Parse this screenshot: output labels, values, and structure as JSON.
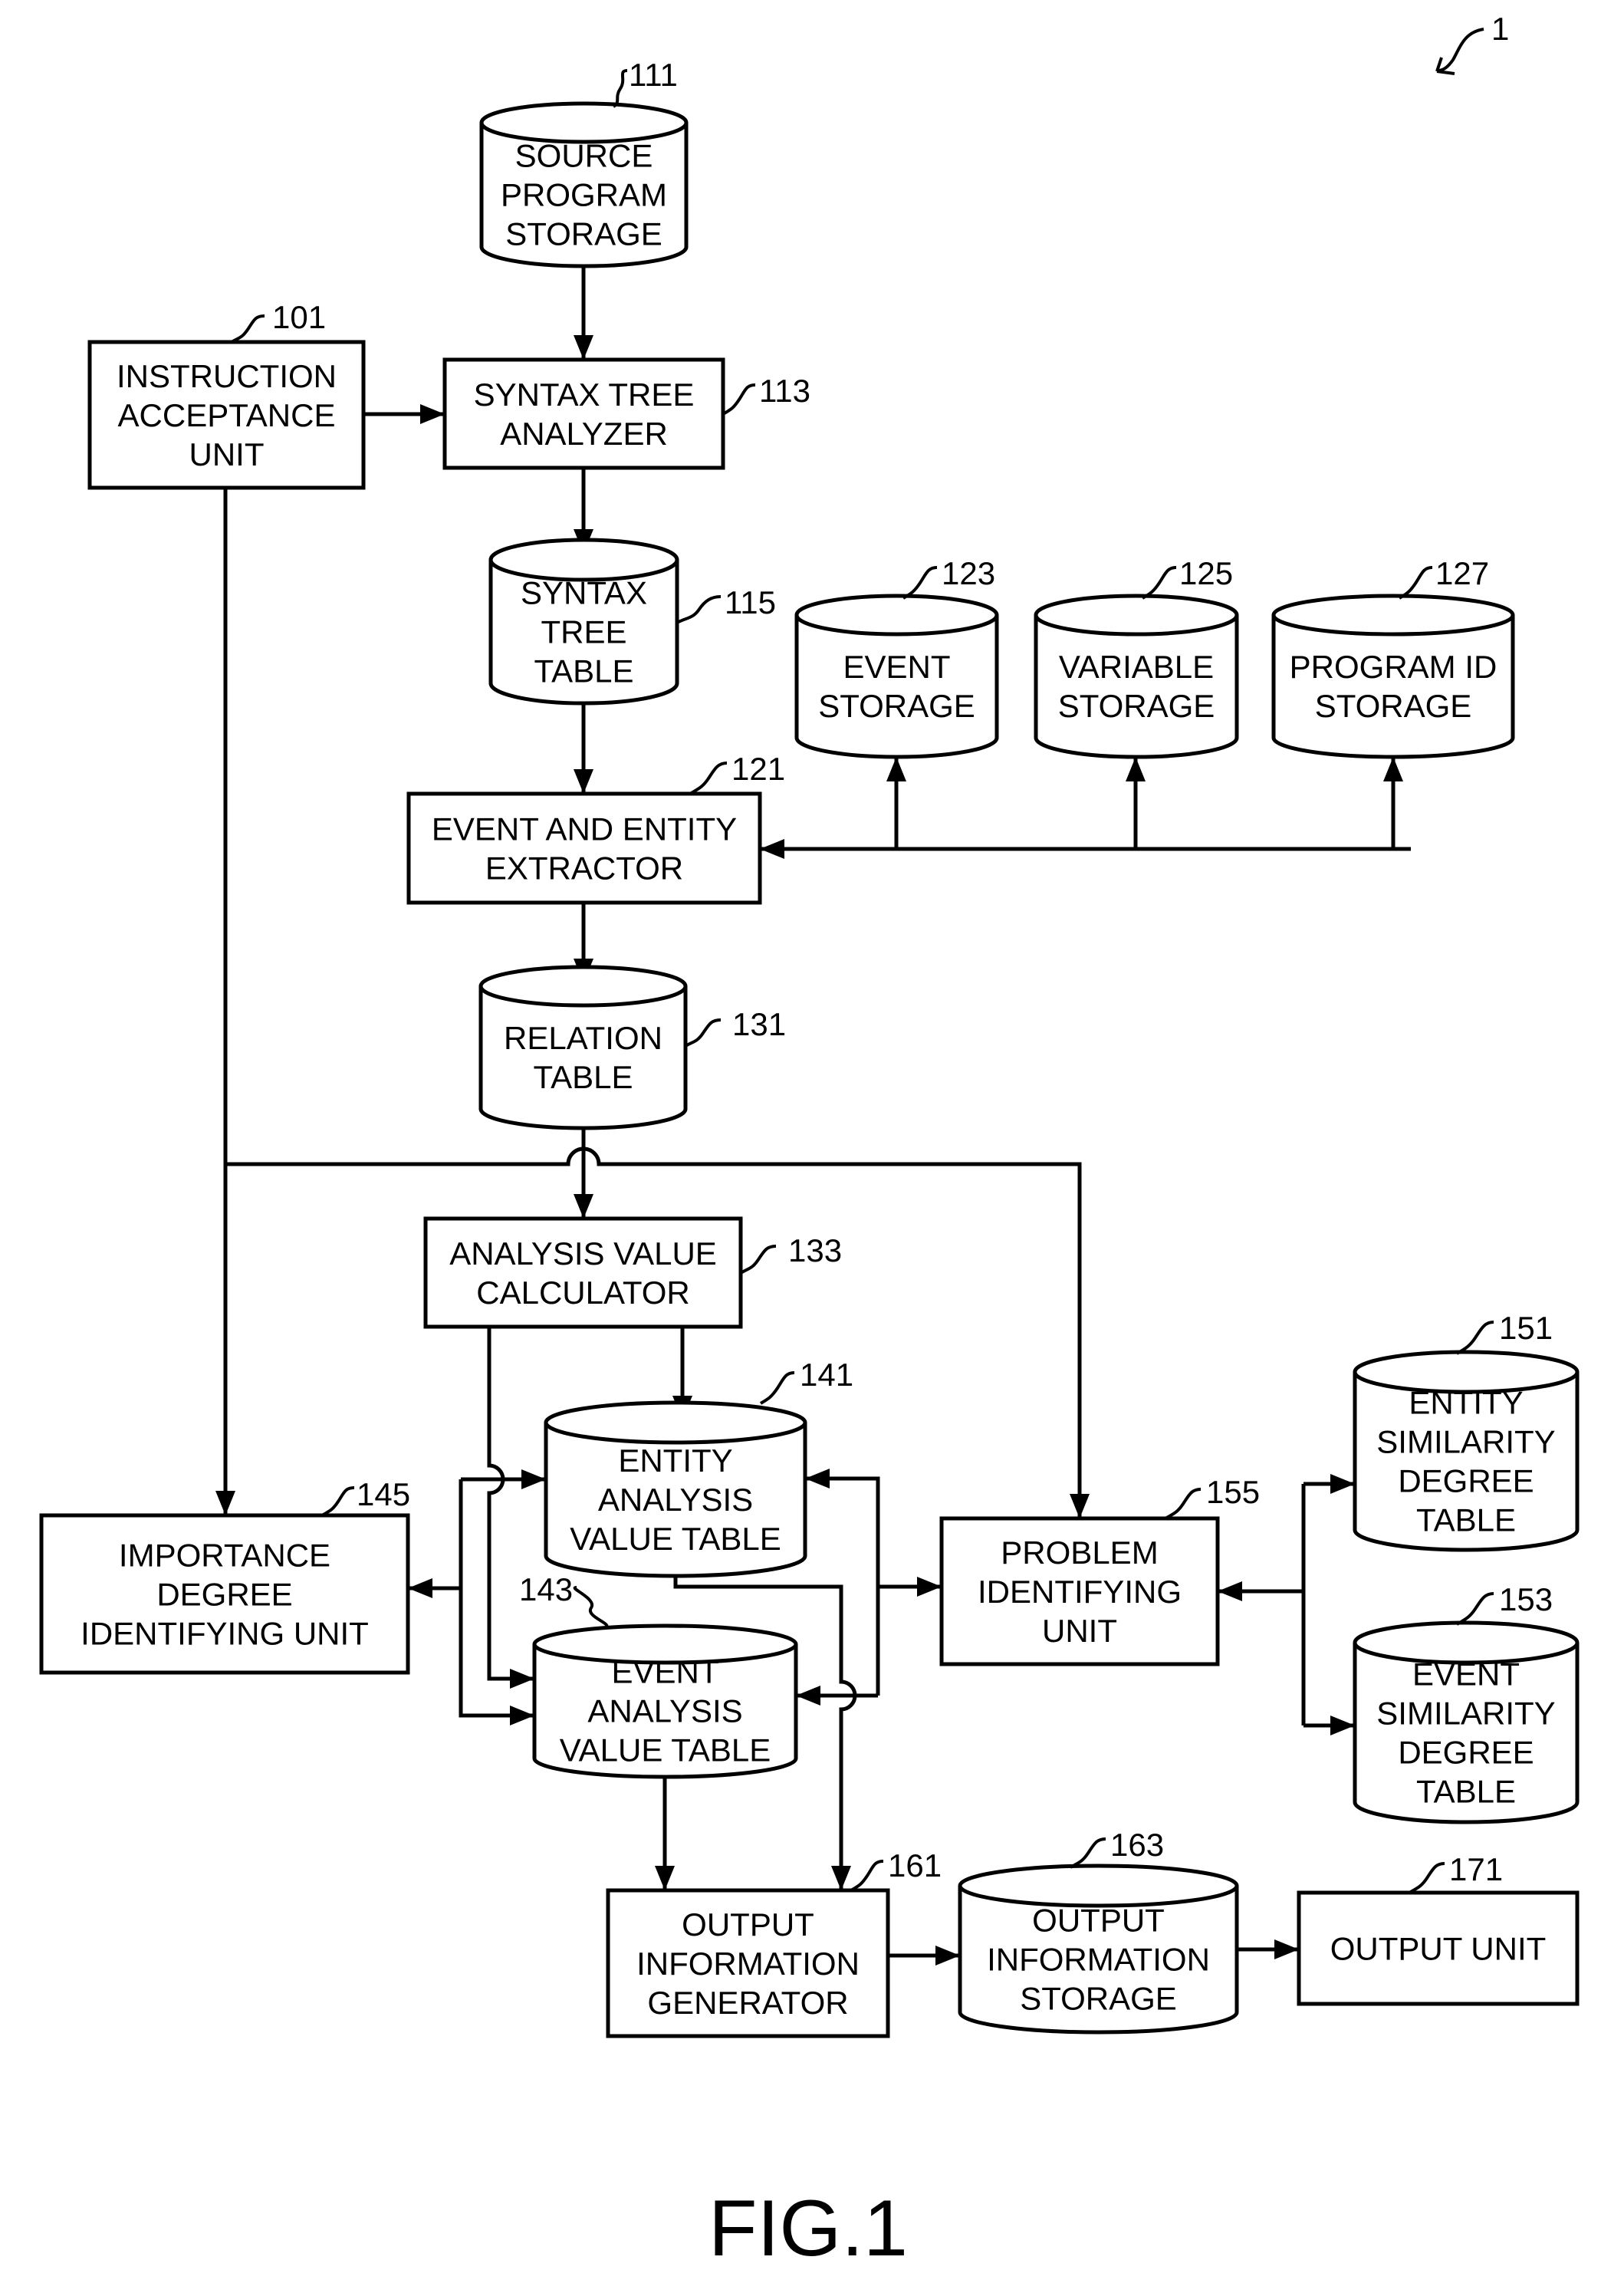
{
  "figure": {
    "label": "FIG.1",
    "system_ref": "1"
  },
  "nodes": {
    "source_program_storage": {
      "ref": "111",
      "type": "storage",
      "lines": [
        "SOURCE",
        "PROGRAM",
        "STORAGE"
      ]
    },
    "instruction_acceptance_unit": {
      "ref": "101",
      "type": "unit",
      "lines": [
        "INSTRUCTION",
        "ACCEPTANCE",
        "UNIT"
      ]
    },
    "syntax_tree_analyzer": {
      "ref": "113",
      "type": "unit",
      "lines": [
        "SYNTAX TREE",
        "ANALYZER"
      ]
    },
    "syntax_tree_table": {
      "ref": "115",
      "type": "storage",
      "lines": [
        "SYNTAX",
        "TREE",
        "TABLE"
      ]
    },
    "event_storage": {
      "ref": "123",
      "type": "storage",
      "lines": [
        "EVENT",
        "STORAGE"
      ]
    },
    "variable_storage": {
      "ref": "125",
      "type": "storage",
      "lines": [
        "VARIABLE",
        "STORAGE"
      ]
    },
    "program_id_storage": {
      "ref": "127",
      "type": "storage",
      "lines": [
        "PROGRAM ID",
        "STORAGE"
      ]
    },
    "event_entity_extractor": {
      "ref": "121",
      "type": "unit",
      "lines": [
        "EVENT AND ENTITY",
        "EXTRACTOR"
      ]
    },
    "relation_table": {
      "ref": "131",
      "type": "storage",
      "lines": [
        "RELATION",
        "TABLE"
      ]
    },
    "analysis_value_calculator": {
      "ref": "133",
      "type": "unit",
      "lines": [
        "ANALYSIS VALUE",
        "CALCULATOR"
      ]
    },
    "entity_analysis_value_table": {
      "ref": "141",
      "type": "storage",
      "lines": [
        "ENTITY",
        "ANALYSIS",
        "VALUE TABLE"
      ]
    },
    "event_analysis_value_table": {
      "ref": "143",
      "type": "storage",
      "lines": [
        "EVENT",
        "ANALYSIS",
        "VALUE TABLE"
      ]
    },
    "importance_degree_identifying_unit": {
      "ref": "145",
      "type": "unit",
      "lines": [
        "IMPORTANCE",
        "DEGREE",
        "IDENTIFYING UNIT"
      ]
    },
    "problem_identifying_unit": {
      "ref": "155",
      "type": "unit",
      "lines": [
        "PROBLEM",
        "IDENTIFYING",
        "UNIT"
      ]
    },
    "entity_similarity_degree_table": {
      "ref": "151",
      "type": "storage",
      "lines": [
        "ENTITY",
        "SIMILARITY",
        "DEGREE",
        "TABLE"
      ]
    },
    "event_similarity_degree_table": {
      "ref": "153",
      "type": "storage",
      "lines": [
        "EVENT",
        "SIMILARITY",
        "DEGREE",
        "TABLE"
      ]
    },
    "output_information_generator": {
      "ref": "161",
      "type": "unit",
      "lines": [
        "OUTPUT",
        "INFORMATION",
        "GENERATOR"
      ]
    },
    "output_information_storage": {
      "ref": "163",
      "type": "storage",
      "lines": [
        "OUTPUT",
        "INFORMATION",
        "STORAGE"
      ]
    },
    "output_unit": {
      "ref": "171",
      "type": "unit",
      "lines": [
        "OUTPUT UNIT"
      ]
    }
  },
  "connections": [
    {
      "from": "source_program_storage",
      "to": "syntax_tree_analyzer"
    },
    {
      "from": "instruction_acceptance_unit",
      "to": "syntax_tree_analyzer"
    },
    {
      "from": "syntax_tree_analyzer",
      "to": "syntax_tree_table"
    },
    {
      "from": "syntax_tree_table",
      "to": "event_entity_extractor"
    },
    {
      "from": "event_entity_extractor",
      "to": "event_storage"
    },
    {
      "from": "event_entity_extractor",
      "to": "variable_storage"
    },
    {
      "from": "event_entity_extractor",
      "to": "program_id_storage"
    },
    {
      "from": "event_storage",
      "to": "event_entity_extractor"
    },
    {
      "from": "event_entity_extractor",
      "to": "relation_table"
    },
    {
      "from": "relation_table",
      "to": "analysis_value_calculator"
    },
    {
      "from": "instruction_acceptance_unit",
      "to": "importance_degree_identifying_unit"
    },
    {
      "from": "instruction_acceptance_unit",
      "to": "problem_identifying_unit"
    },
    {
      "from": "analysis_value_calculator",
      "to": "entity_analysis_value_table"
    },
    {
      "from": "analysis_value_calculator",
      "to": "event_analysis_value_table"
    },
    {
      "from": "importance_degree_identifying_unit",
      "to": "entity_analysis_value_table"
    },
    {
      "from": "importance_degree_identifying_unit",
      "to": "event_analysis_value_table"
    },
    {
      "from": "problem_identifying_unit",
      "to": "entity_analysis_value_table"
    },
    {
      "from": "problem_identifying_unit",
      "to": "event_analysis_value_table"
    },
    {
      "from": "problem_identifying_unit",
      "to": "entity_similarity_degree_table"
    },
    {
      "from": "problem_identifying_unit",
      "to": "event_similarity_degree_table"
    },
    {
      "from": "entity_analysis_value_table",
      "to": "output_information_generator"
    },
    {
      "from": "event_analysis_value_table",
      "to": "output_information_generator"
    },
    {
      "from": "output_information_generator",
      "to": "output_information_storage"
    },
    {
      "from": "output_information_storage",
      "to": "output_unit"
    }
  ]
}
